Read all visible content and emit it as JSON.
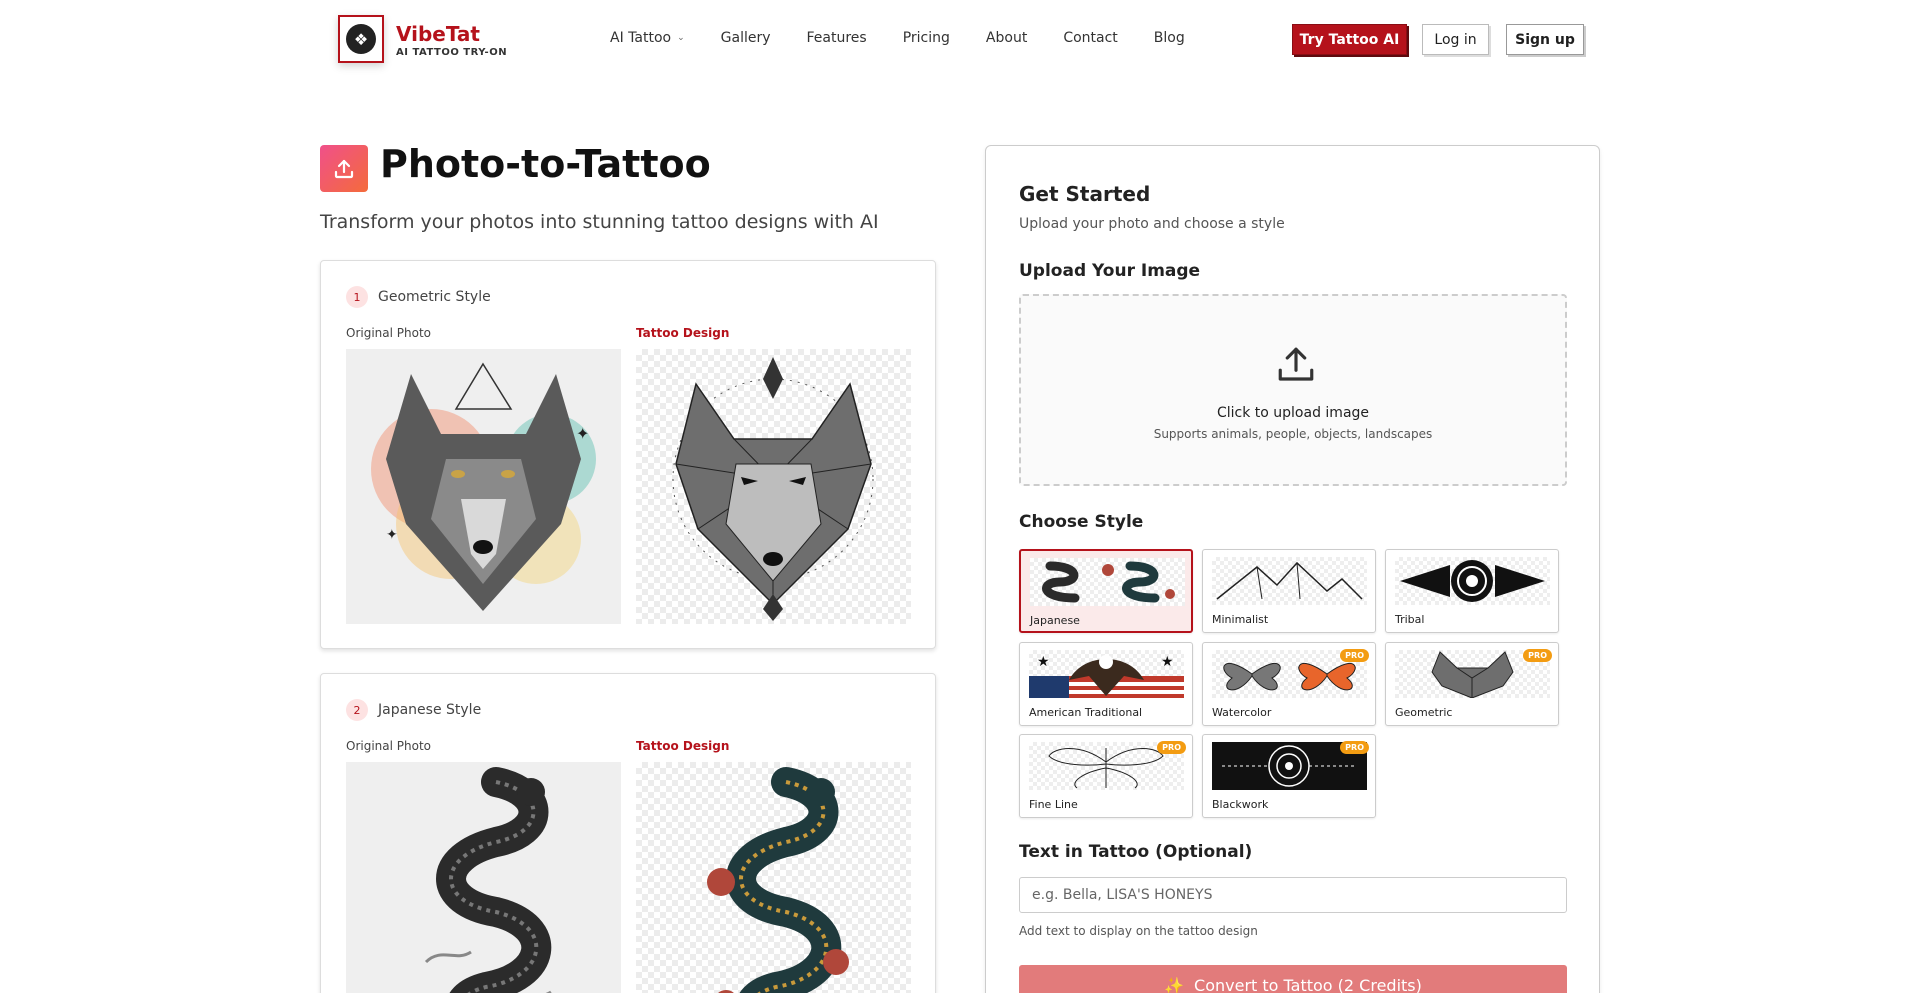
{
  "brand": {
    "name": "VibeTat",
    "tagline": "AI TATTOO TRY-ON"
  },
  "nav": {
    "items": [
      {
        "label": "AI Tattoo",
        "has_dropdown": true
      },
      {
        "label": "Gallery"
      },
      {
        "label": "Features"
      },
      {
        "label": "Pricing"
      },
      {
        "label": "About"
      },
      {
        "label": "Contact"
      },
      {
        "label": "Blog"
      }
    ],
    "try_label": "Try Tattoo AI",
    "login_label": "Log in",
    "signup_label": "Sign up"
  },
  "hero": {
    "title": "Photo-to-Tattoo",
    "subtitle": "Transform your photos into stunning tattoo designs with AI"
  },
  "examples": [
    {
      "number": "1",
      "style": "Geometric Style",
      "original_label": "Original Photo",
      "design_label": "Tattoo Design"
    },
    {
      "number": "2",
      "style": "Japanese Style",
      "original_label": "Original Photo",
      "design_label": "Tattoo Design"
    }
  ],
  "panel": {
    "title": "Get Started",
    "subtitle": "Upload your photo and choose a style",
    "upload_heading": "Upload Your Image",
    "upload_text": "Click to upload image",
    "upload_sub": "Supports animals, people, objects, landscapes",
    "style_heading": "Choose Style",
    "styles": [
      {
        "label": "Japanese",
        "pro": false,
        "selected": true
      },
      {
        "label": "Minimalist",
        "pro": false
      },
      {
        "label": "Tribal",
        "pro": false
      },
      {
        "label": "American Traditional",
        "pro": false
      },
      {
        "label": "Watercolor",
        "pro": true
      },
      {
        "label": "Geometric",
        "pro": true
      },
      {
        "label": "Fine Line",
        "pro": true
      },
      {
        "label": "Blackwork",
        "pro": true
      }
    ],
    "pro_badge": "PRO",
    "text_heading": "Text in Tattoo (Optional)",
    "text_placeholder": "e.g. Bella, LISA'S HONEYS",
    "text_value": "",
    "text_hint": "Add text to display on the tattoo design",
    "convert_label": "Convert to Tattoo (2 Credits)"
  },
  "colors": {
    "brand": "#b5121b",
    "pro": "#f39c12",
    "convert": "#e27b7b"
  }
}
